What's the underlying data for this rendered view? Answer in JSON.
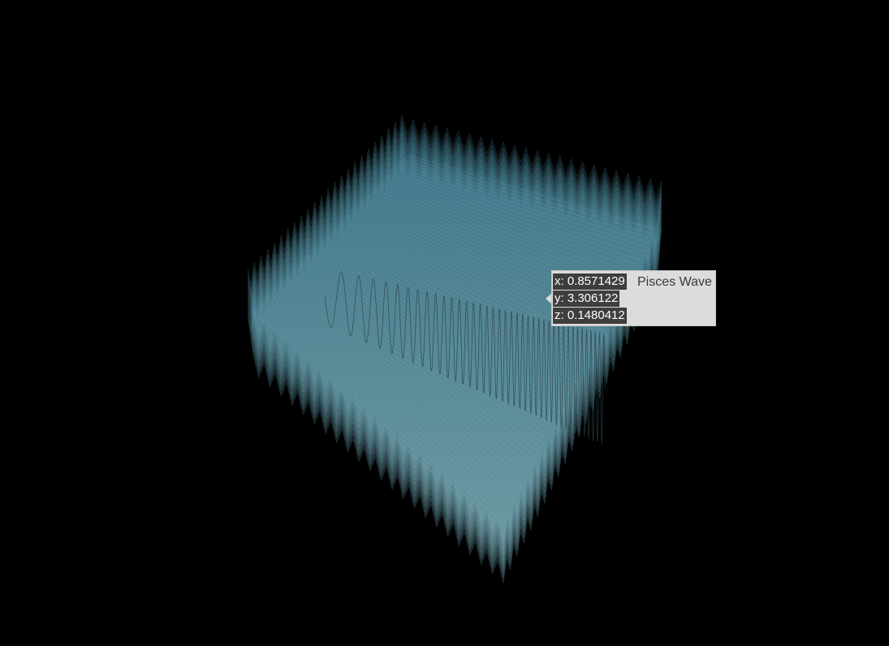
{
  "chart_data": {
    "type": "surface3d",
    "title": "",
    "series": [
      {
        "name": "Pisces Wave",
        "color": "#5ba8be",
        "surface": "z = 0.5*sin(3*x*y)"
      }
    ],
    "hover": {
      "x_text": "x: 0.8571429",
      "y_text": "y: 3.306122",
      "z_text": "z: 0.1480412",
      "series_name": "Pisces Wave",
      "x": 0.8571429,
      "y": 3.306122,
      "z": 0.1480412
    },
    "background": "#000000",
    "axes_visible": false,
    "grid": false
  }
}
